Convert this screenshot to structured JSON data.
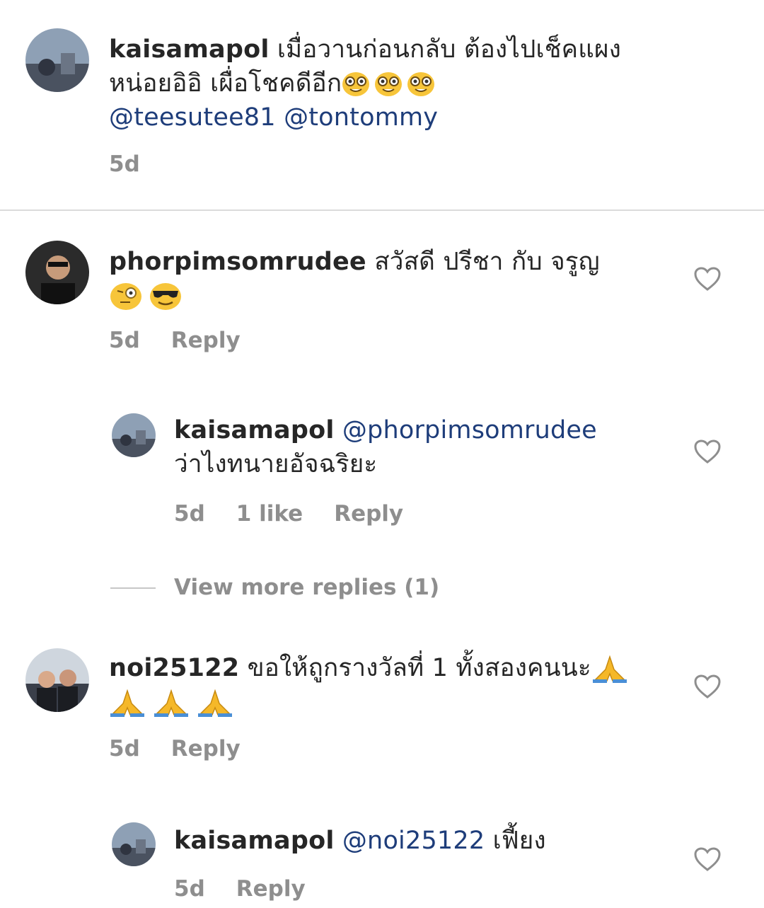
{
  "post": {
    "username": "kaisamapol",
    "text_line1": "เมื่อวานก่อนกลับ ต้องไปเช็คแผง",
    "text_line2": "หน่อยอิอิ เผื่อโชคดีอีก",
    "emojis": [
      "nerd-face-emoji",
      "nerd-face-emoji",
      "nerd-face-emoji"
    ],
    "mention1": "@teesutee81",
    "mention2": "@tontommy",
    "time": "5d"
  },
  "comments": [
    {
      "username": "phorpimsomrudee",
      "text": "สวัสดี ปรีชา กับ จรูญ",
      "emojis": [
        "monocle-face-emoji",
        "sunglasses-face-emoji"
      ],
      "time": "5d",
      "reply_label": "Reply",
      "replies": [
        {
          "username": "kaisamapol",
          "mention": "@phorpimsomrudee",
          "text": "ว่าไงทนายอัจฉริยะ",
          "time": "5d",
          "likes": "1 like",
          "reply_label": "Reply"
        }
      ],
      "view_more": "View more replies (1)"
    },
    {
      "username": "noi25122",
      "text": "ขอให้ถูกรางวัลที่ 1 ทั้งสองคนนะ",
      "emojis": [
        "folded-hands-emoji",
        "folded-hands-emoji",
        "folded-hands-emoji",
        "folded-hands-emoji"
      ],
      "time": "5d",
      "reply_label": "Reply",
      "replies": [
        {
          "username": "kaisamapol",
          "mention": "@noi25122",
          "text": "เฟี้ยง",
          "time": "5d",
          "reply_label": "Reply"
        }
      ]
    }
  ],
  "colors": {
    "mention": "#1e3d7a",
    "meta": "#8e8e8e",
    "divider": "#dbdbdb"
  }
}
